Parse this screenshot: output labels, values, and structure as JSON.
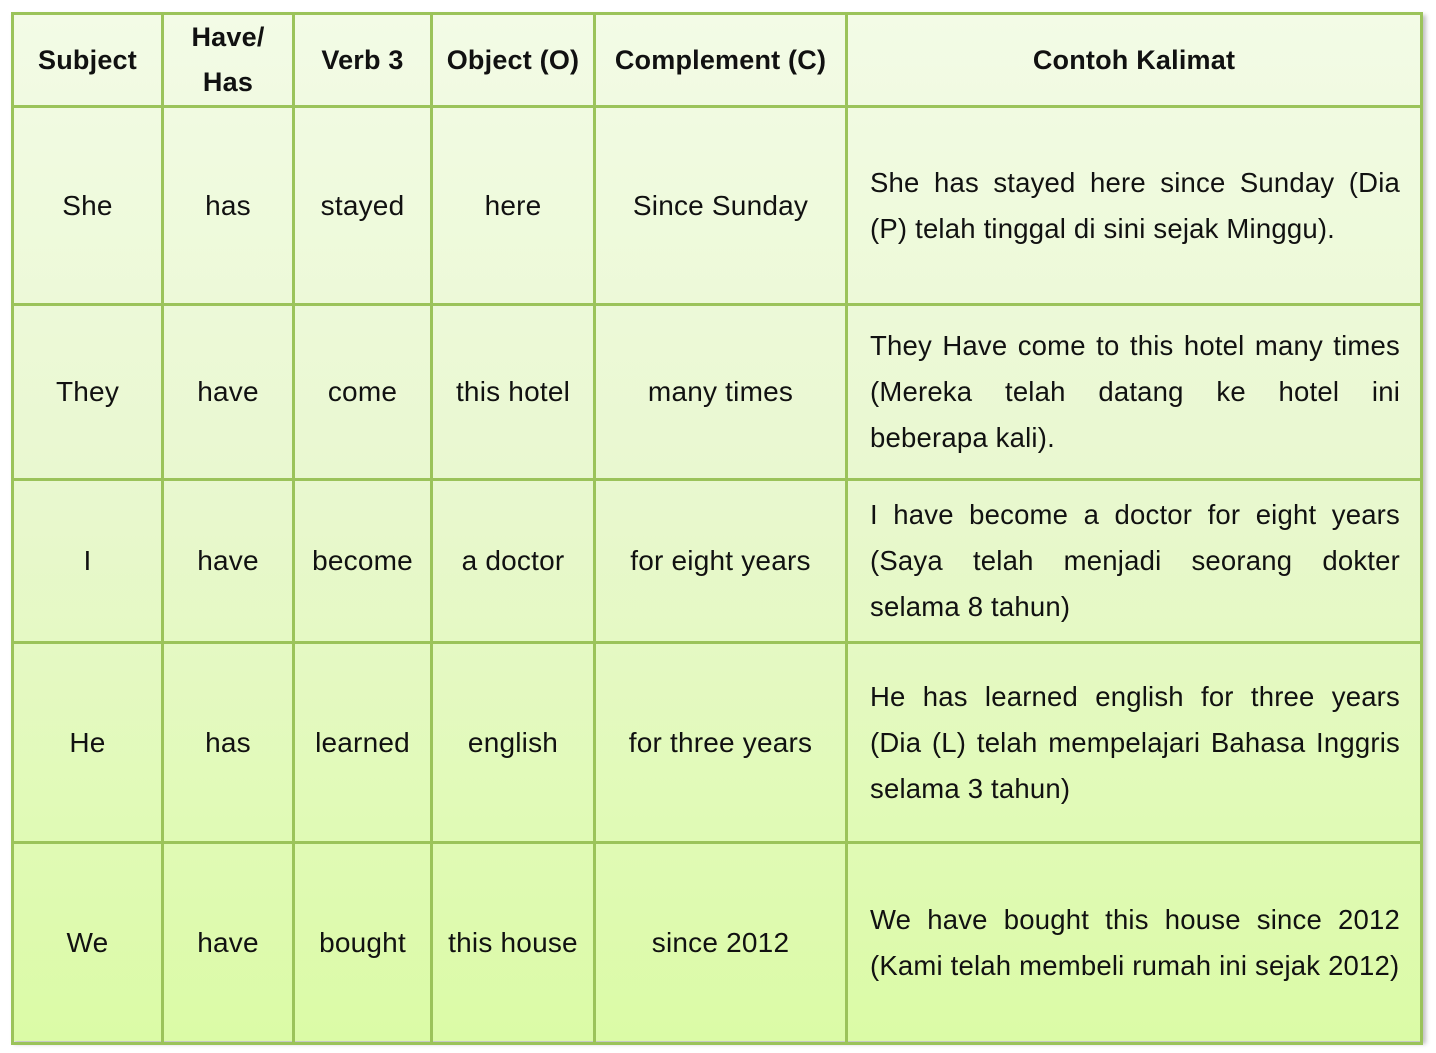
{
  "table": {
    "headers": [
      "Subject",
      "Have/ Has",
      "Verb 3",
      "Object (O)",
      "Complement (C)",
      "Contoh Kalimat"
    ],
    "rows": [
      {
        "subject": "She",
        "have_has": "has",
        "verb3": "stayed",
        "object": "here",
        "complement": "Since Sunday",
        "example": "She has stayed here since Sunday (Dia (P) telah tinggal di sini sejak Minggu)."
      },
      {
        "subject": "They",
        "have_has": "have",
        "verb3": "come",
        "object": "this hotel",
        "complement": "many times",
        "example": "They Have come to this hotel many times (Mereka telah datang ke hotel ini beberapa kali)."
      },
      {
        "subject": "I",
        "have_has": "have",
        "verb3": "become",
        "object": "a doctor",
        "complement": "for eight years",
        "example": "I have become a doctor for eight years (Saya telah menjadi seorang dokter selama 8 tahun)"
      },
      {
        "subject": "He",
        "have_has": "has",
        "verb3": "learned",
        "object": "english",
        "complement": "for three years",
        "example": "He has learned english for three years (Dia (L) telah mempelajari Bahasa Inggris selama 3 tahun)"
      },
      {
        "subject": "We",
        "have_has": "have",
        "verb3": "bought",
        "object": "this house",
        "complement": "since 2012",
        "example": "We have bought this house since 2012 (Kami telah membeli rumah ini sejak 2012)"
      }
    ]
  },
  "colors": {
    "border": "#9bc35a",
    "fill_top": "#f3fbe6",
    "fill_bottom": "#dbfba6"
  }
}
